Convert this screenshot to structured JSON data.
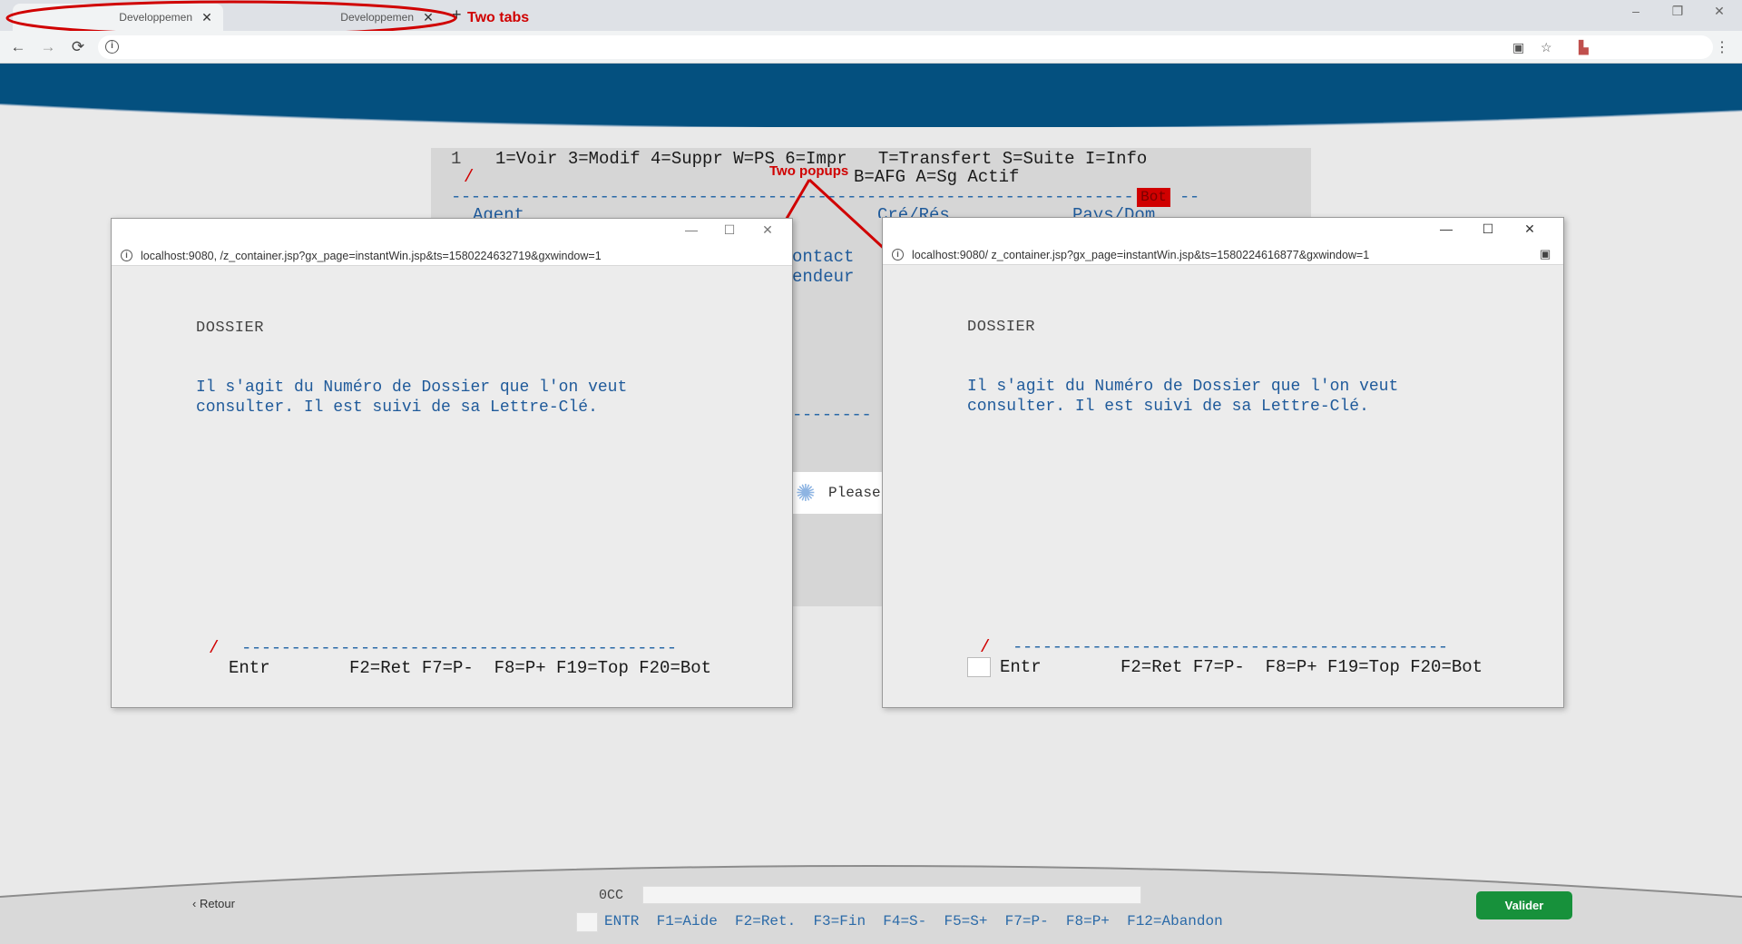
{
  "browser": {
    "tabs": [
      {
        "title": "Developpemen",
        "close": "✕"
      },
      {
        "title": "Developpemen",
        "close": "✕"
      }
    ],
    "new_tab": "+",
    "window_controls": [
      "–",
      "❐",
      "✕"
    ],
    "nav": {
      "back": "←",
      "forward": "→",
      "reload": "⟳"
    },
    "omnibox_info": "i",
    "toolbar_icons": {
      "clipboard": "▣",
      "star": "☆",
      "pdf": "⬛",
      "menu": "⋮"
    }
  },
  "annotations": {
    "tabs_note": "Two tabs",
    "popups_note": "Two popups",
    "accent_color": "#d00000"
  },
  "terminal": {
    "line_number": "1",
    "options_line1": "1=Voir 3=Modif 4=Suppr W=PS 6=Impr   T=Transfert S=Suite I=Info",
    "options_line2": "B=AFG A=Sg Actif",
    "dashes": "----------------------------------------------------------------------",
    "dashes_tail": "--",
    "bot_badge": "Bot",
    "col_agent": "Agent",
    "col_cre": "Cré/Rés",
    "col_pays": "Pays/Dom",
    "col_contact": "ontact",
    "col_vendeur": "endeur",
    "mid_dashes": "--------"
  },
  "loading": {
    "text": "Please"
  },
  "popup_left": {
    "url": "localhost:9080,             /z_container.jsp?gx_page=instantWin.jsp&ts=1580224632719&gxwindow=1",
    "heading": "DOSSIER",
    "body_line1": "Il s'agit du Numéro de Dossier que l'on veut",
    "body_line2": "consulter. Il est suivi de sa Lettre-Clé.",
    "slash": "/",
    "dashes": "--------------------------------------------",
    "entr": "Entr",
    "fkeys": "F2=Ret F7=P-  F8=P+ F19=Top F20=Bot",
    "controls": [
      "—",
      "☐",
      "✕"
    ]
  },
  "popup_right": {
    "url": "localhost:9080/             z_container.jsp?gx_page=instantWin.jsp&ts=1580224616877&gxwindow=1",
    "heading": "DOSSIER",
    "body_line1": "Il s'agit du Numéro de Dossier que l'on veut",
    "body_line2": "consulter. Il est suivi de sa Lettre-Clé.",
    "slash": "/",
    "dashes": "--------------------------------------------",
    "entr": "Entr",
    "fkeys": "F2=Ret F7=P-  F8=P+ F19=Top F20=Bot",
    "controls": [
      "—",
      "☐",
      "✕"
    ],
    "clipboard_icon": "▣"
  },
  "footer": {
    "retour": "‹ Retour",
    "occ_label": "0CC",
    "fkey_bar": "ENTR  F1=Aide  F2=Ret.  F3=Fin  F4=S-  F5=S+  F7=P-  F8=P+  F12=Abandon",
    "valider": "Valider",
    "valider_color": "#17913b"
  },
  "colors": {
    "header_blue": "#04507f",
    "terminal_blue": "#1f5a9a"
  }
}
